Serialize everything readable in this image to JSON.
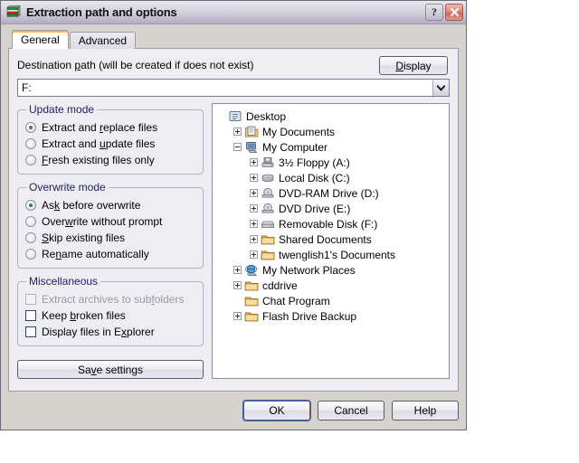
{
  "window": {
    "title": "Extraction path and options",
    "icon": "books-icon",
    "help_button": "?",
    "close_button": "✕"
  },
  "tabs": [
    {
      "label": "General",
      "active": true
    },
    {
      "label": "Advanced",
      "active": false
    }
  ],
  "destination": {
    "label_pre": "Destination ",
    "label_accel": "p",
    "label_post": "ath (will be created if does not exist)",
    "value": "F:",
    "dropdown_icon": "chevron-down-icon",
    "display_button": {
      "pre": "",
      "accel": "D",
      "post": "isplay"
    }
  },
  "update_mode": {
    "legend": "Update mode",
    "options": [
      {
        "pre": "Extract and ",
        "accel": "r",
        "post": "eplace files",
        "selected": true
      },
      {
        "pre": "Extract and ",
        "accel": "u",
        "post": "pdate files",
        "selected": false
      },
      {
        "pre": "",
        "accel": "F",
        "post": "resh existing files only",
        "selected": false
      }
    ]
  },
  "overwrite_mode": {
    "legend": "Overwrite mode",
    "options": [
      {
        "pre": "As",
        "accel": "k",
        "post": " before overwrite",
        "selected": true
      },
      {
        "pre": "Over",
        "accel": "w",
        "post": "rite without prompt",
        "selected": false
      },
      {
        "pre": "",
        "accel": "S",
        "post": "kip existing files",
        "selected": false
      },
      {
        "pre": "Re",
        "accel": "n",
        "post": "ame automatically",
        "selected": false
      }
    ]
  },
  "miscellaneous": {
    "legend": "Miscellaneous",
    "options": [
      {
        "pre": "Extract archives to sub",
        "accel": "f",
        "post": "olders",
        "checked": false,
        "disabled": true
      },
      {
        "pre": "Keep ",
        "accel": "b",
        "post": "roken files",
        "checked": false,
        "disabled": false
      },
      {
        "pre": "Display files in E",
        "accel": "x",
        "post": "plorer",
        "checked": false,
        "disabled": false
      }
    ]
  },
  "save_settings_button": {
    "pre": "Sa",
    "accel": "v",
    "post": "e settings"
  },
  "tree": {
    "nodes": [
      {
        "label": "Desktop",
        "indent": 0,
        "expander": "none",
        "icon": "desktop-icon"
      },
      {
        "label": "My Documents",
        "indent": 1,
        "expander": "plus",
        "icon": "my-documents-icon"
      },
      {
        "label": "My Computer",
        "indent": 1,
        "expander": "minus",
        "icon": "my-computer-icon"
      },
      {
        "label": "3½ Floppy (A:)",
        "indent": 2,
        "expander": "plus",
        "icon": "floppy-drive-icon"
      },
      {
        "label": "Local Disk (C:)",
        "indent": 2,
        "expander": "plus",
        "icon": "hard-disk-icon"
      },
      {
        "label": "DVD-RAM Drive (D:)",
        "indent": 2,
        "expander": "plus",
        "icon": "optical-drive-icon"
      },
      {
        "label": "DVD Drive (E:)",
        "indent": 2,
        "expander": "plus",
        "icon": "optical-drive-icon"
      },
      {
        "label": "Removable Disk (F:)",
        "indent": 2,
        "expander": "plus",
        "icon": "removable-disk-icon"
      },
      {
        "label": "Shared Documents",
        "indent": 2,
        "expander": "plus",
        "icon": "folder-icon"
      },
      {
        "label": "twenglish1's Documents",
        "indent": 2,
        "expander": "plus",
        "icon": "folder-icon"
      },
      {
        "label": "My Network Places",
        "indent": 1,
        "expander": "plus",
        "icon": "network-icon"
      },
      {
        "label": "cddrive",
        "indent": 1,
        "expander": "plus",
        "icon": "folder-icon"
      },
      {
        "label": "Chat Program",
        "indent": 1,
        "expander": "none",
        "icon": "folder-icon"
      },
      {
        "label": "Flash Drive Backup",
        "indent": 1,
        "expander": "plus",
        "icon": "folder-icon"
      }
    ]
  },
  "buttons": [
    {
      "label": "OK",
      "default": true
    },
    {
      "label": "Cancel",
      "default": false
    },
    {
      "label": "Help",
      "default": false
    }
  ],
  "colors": {
    "dialog_face": "#d6d3ce",
    "panel": "#eeedf2",
    "legend_text": "#1e1e6e",
    "radio_dot": "#2f8f2f",
    "tab_accent": "#f6b93b",
    "close_red": "#d4685a",
    "default_focus": "#3a63b8"
  }
}
